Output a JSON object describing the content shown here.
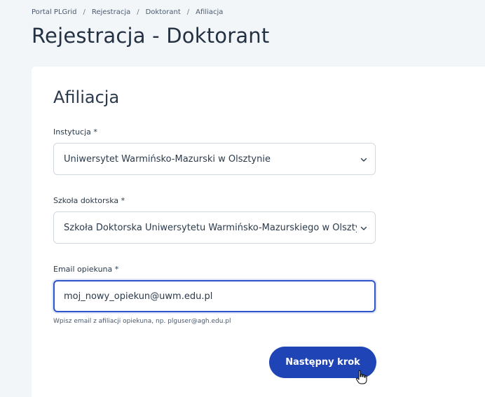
{
  "breadcrumb": {
    "items": [
      "Portal PLGrid",
      "Rejestracja",
      "Doktorant",
      "Afiliacja"
    ],
    "separator": "/"
  },
  "page_title": "Rejestracja - Doktorant",
  "form": {
    "section_title": "Afiliacja",
    "institution": {
      "label": "Instytucja *",
      "value": "Uniwersytet Warmińsko-Mazurski w Olsztynie"
    },
    "doctoral_school": {
      "label": "Szkoła doktorska *",
      "value": "Szkoła Doktorska Uniwersytetu Warmińsko-Mazurskiego w Olsztynie"
    },
    "supervisor_email": {
      "label": "Email opiekuna *",
      "value": "moj_nowy_opiekun@uwm.edu.pl",
      "help": "Wpisz email z afiliacji opiekuna, np. plguser@agh.edu.pl"
    },
    "next_label": "Następny krok"
  },
  "colors": {
    "accent": "#1f44b6",
    "focus_border": "#2f56c8",
    "background": "#f3f6f9"
  },
  "icons": {
    "select_chevron": "chevron-down-icon",
    "cursor": "hand-pointer-icon"
  }
}
